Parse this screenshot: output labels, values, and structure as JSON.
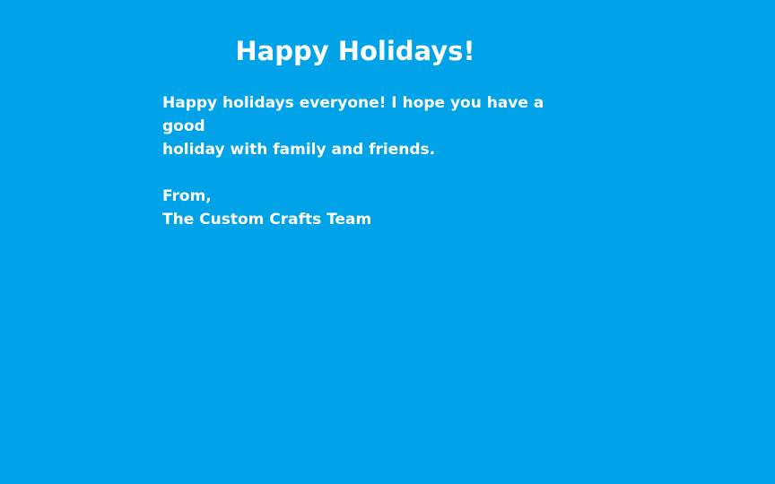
{
  "message": {
    "title": "Happy Holidays!",
    "body_line_1": "Happy holidays everyone! I hope you have a good",
    "body_line_2": "holiday with family and friends.",
    "signoff": "From,",
    "signature": "The Custom Crafts Team"
  },
  "colors": {
    "background": "#00A2E8",
    "text": "#FFFFFF"
  }
}
